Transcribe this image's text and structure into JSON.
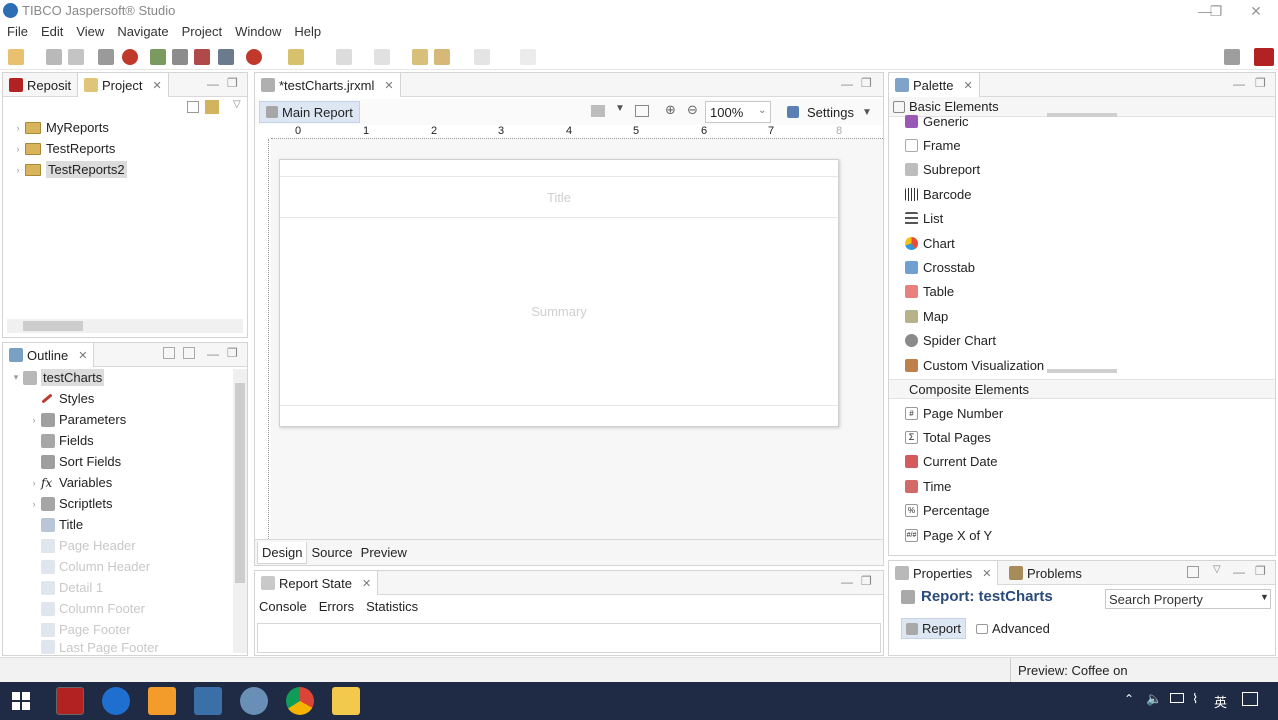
{
  "window": {
    "title": "TIBCO Jaspersoft® Studio"
  },
  "menu": [
    "File",
    "Edit",
    "View",
    "Navigate",
    "Project",
    "Window",
    "Help"
  ],
  "left_top": {
    "tabs": [
      "Reposit",
      "Project"
    ],
    "items": [
      "MyReports",
      "TestReports",
      "TestReports2"
    ]
  },
  "outline": {
    "tab": "Outline",
    "root": "testCharts",
    "items": [
      "Styles",
      "Parameters",
      "Fields",
      "Sort Fields",
      "Variables",
      "Scriptlets",
      "Title",
      "Page Header",
      "Column Header",
      "Detail 1",
      "Column Footer",
      "Page Footer",
      "Last Page Footer"
    ]
  },
  "editor": {
    "tab": "*testCharts.jrxml",
    "main_report": "Main Report",
    "zoom": "100%",
    "settings": "Settings",
    "ruler": [
      "0",
      "1",
      "2",
      "3",
      "4",
      "5",
      "6",
      "7",
      "8"
    ],
    "band_title": "Title",
    "band_summary": "Summary",
    "bottom_tabs": [
      "Design",
      "Source",
      "Preview"
    ]
  },
  "report_state": {
    "tab": "Report State",
    "tabs": [
      "Console",
      "Errors",
      "Statistics"
    ]
  },
  "palette": {
    "tab": "Palette",
    "basic_header": "Basic Elements",
    "basic": [
      "Generic",
      "Frame",
      "Subreport",
      "Barcode",
      "List",
      "Chart",
      "Crosstab",
      "Table",
      "Map",
      "Spider Chart",
      "Custom Visualization"
    ],
    "composite_header": "Composite Elements",
    "composite": [
      "Page Number",
      "Total Pages",
      "Current Date",
      "Time",
      "Percentage",
      "Page X of Y"
    ]
  },
  "properties": {
    "tabs": [
      "Properties",
      "Problems"
    ],
    "title": "Report: testCharts",
    "search_placeholder": "Search Property",
    "subtabs": [
      "Report",
      "Advanced"
    ]
  },
  "status": {
    "text": "Preview: Coffee on"
  },
  "tray": {
    "lang": "英"
  }
}
